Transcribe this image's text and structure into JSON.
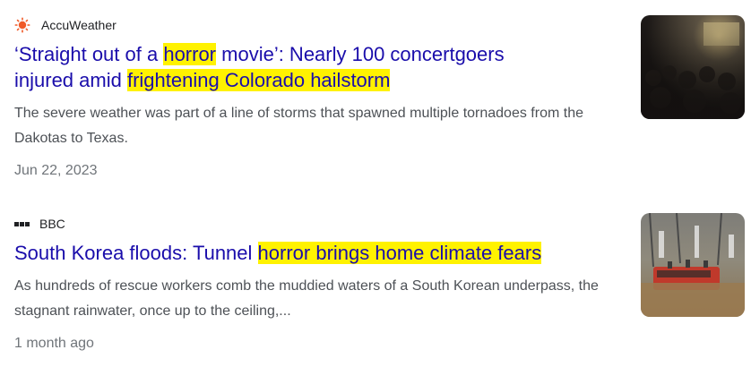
{
  "results": [
    {
      "source": {
        "name": "AccuWeather",
        "icon": "sun-icon",
        "icon_color": "#f05a28"
      },
      "headline": {
        "line1_pre": "‘Straight out of a ",
        "line1_hl1": "horror",
        "line1_post": " movie’: Nearly 100 concertgoers",
        "line2_pre": "injured amid ",
        "line2_hl": "frightening Colorado hailstorm"
      },
      "snippet": "The severe weather was part of a line of storms that spawned multiple tornadoes from the Dakotas to Texas.",
      "date": "Jun 22, 2023",
      "thumbnail": "concert-crowd-image"
    },
    {
      "source": {
        "name": "BBC",
        "icon": "bbc-logo-icon"
      },
      "headline": {
        "pre": "South Korea floods: Tunnel ",
        "hl": "horror brings home climate fears"
      },
      "snippet": "As hundreds of rescue workers comb the muddied waters of a South Korean underpass, the stagnant rainwater, once up to the ceiling,...",
      "date": "1 month ago",
      "thumbnail": "flooded-bus-image"
    }
  ],
  "colors": {
    "link": "#1a0dab",
    "highlight": "#fff200",
    "snippet": "#4d5156",
    "date": "#70757a"
  }
}
